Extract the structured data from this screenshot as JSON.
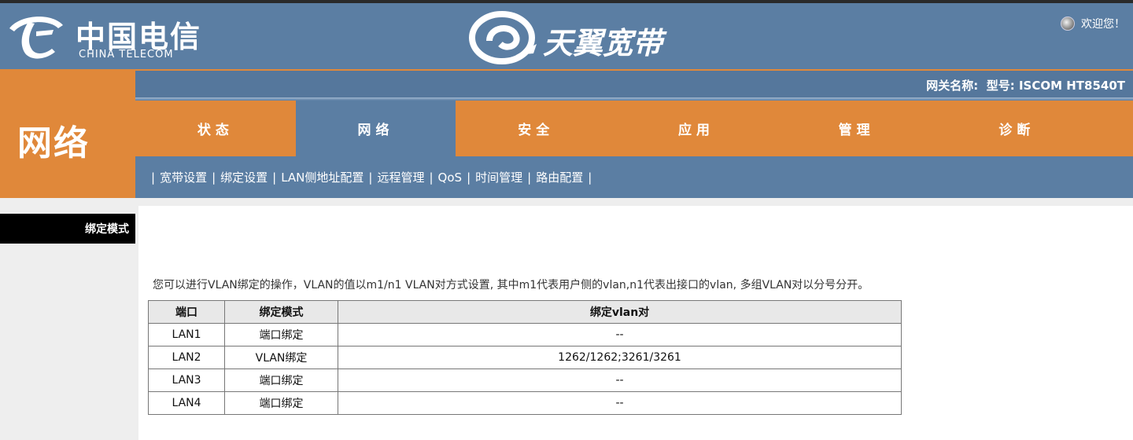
{
  "header": {
    "brand_cn": "中国电信",
    "brand_en": "CHINA TELECOM",
    "product": "天翼宽带",
    "welcome": "欢迎您！"
  },
  "gateway": {
    "label": "网关名称:",
    "model": "型号: ISCOM HT8540T"
  },
  "section_title": "网络",
  "tabs": [
    {
      "label": "状态",
      "active": false
    },
    {
      "label": "网络",
      "active": true
    },
    {
      "label": "安全",
      "active": false
    },
    {
      "label": "应用",
      "active": false
    },
    {
      "label": "管理",
      "active": false
    },
    {
      "label": "诊断",
      "active": false
    }
  ],
  "submenu": [
    "宽带设置",
    "绑定设置",
    "LAN侧地址配置",
    "远程管理",
    "QoS",
    "时间管理",
    "路由配置"
  ],
  "sidebar": {
    "active_item": "绑定模式"
  },
  "main": {
    "description": "您可以进行VLAN绑定的操作，VLAN的值以m1/n1 VLAN对方式设置, 其中m1代表用户侧的vlan,n1代表出接口的vlan, 多组VLAN对以分号分开。",
    "table": {
      "headers": [
        "端口",
        "绑定模式",
        "绑定vlan对"
      ],
      "rows": [
        [
          "LAN1",
          "端口绑定",
          "--"
        ],
        [
          "LAN2",
          "VLAN绑定",
          "1262/1262;3261/3261"
        ],
        [
          "LAN3",
          "端口绑定",
          "--"
        ],
        [
          "LAN4",
          "端口绑定",
          "--"
        ]
      ]
    }
  },
  "colors": {
    "header_blue": "#5b7ea3",
    "accent_orange": "#e0883a",
    "sidebar_active": "#000000"
  },
  "icons": {
    "brand": "china-telecom-logo-icon",
    "product": "tianyi-swirl-logo-icon",
    "welcome": "user-globe-icon"
  }
}
